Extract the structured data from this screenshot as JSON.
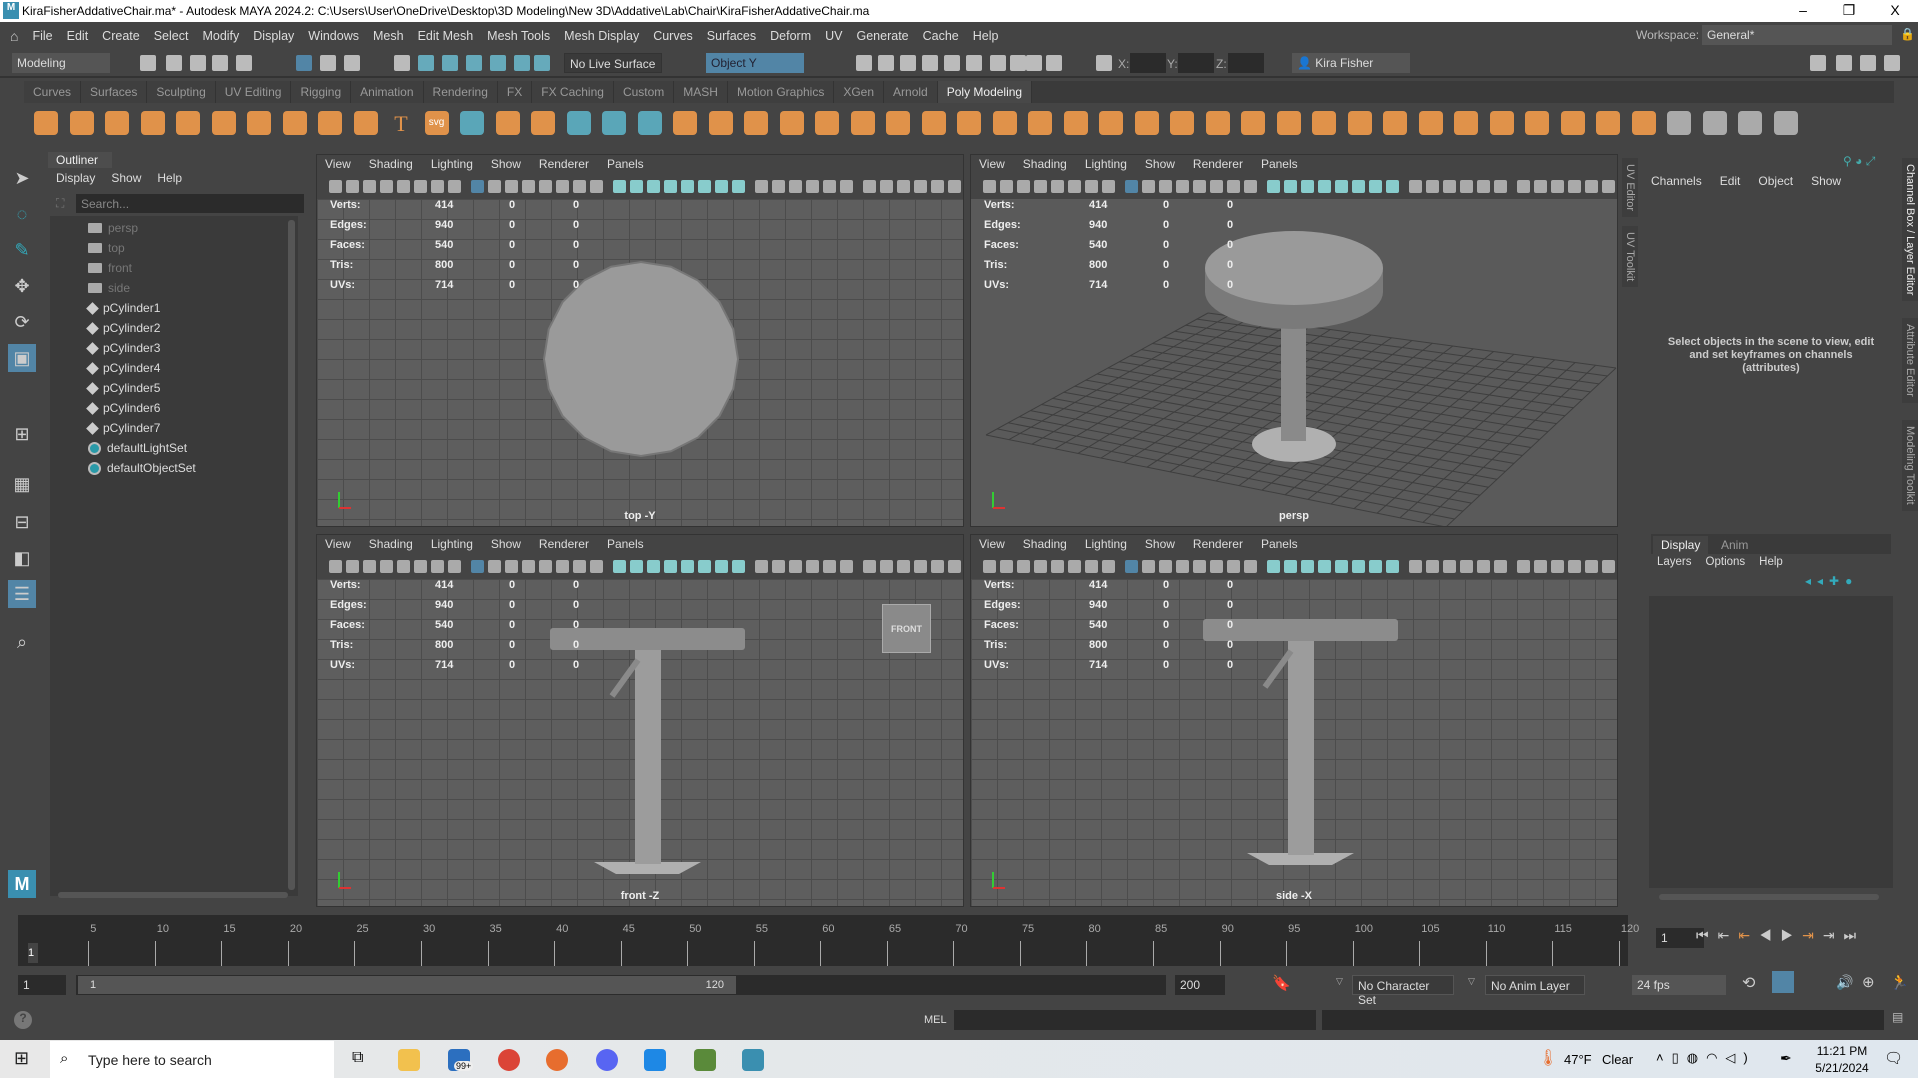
{
  "window": {
    "title": "KiraFisherAddativeChair.ma* - Autodesk MAYA 2024.2: C:\\Users\\User\\OneDrive\\Desktop\\3D Modeling\\New 3D\\Addative\\Lab\\Chair\\KiraFisherAddativeChair.ma",
    "logo": "M",
    "minimize": "–",
    "maximize": "❐",
    "close": "X"
  },
  "menu": [
    "File",
    "Edit",
    "Create",
    "Select",
    "Modify",
    "Display",
    "Windows",
    "Mesh",
    "Edit Mesh",
    "Mesh Tools",
    "Mesh Display",
    "Curves",
    "Surfaces",
    "Deform",
    "UV",
    "Generate",
    "Cache",
    "Help"
  ],
  "workspace": {
    "label": "Workspace:",
    "value": "General*"
  },
  "toolbar": {
    "mode": "Modeling",
    "live_surface": "No Live Surface",
    "symmetry": "Object Y",
    "x_label": "X:",
    "y_label": "Y:",
    "z_label": "Z:",
    "user": "Kira Fisher"
  },
  "shelf": {
    "tabs": [
      "Curves",
      "Surfaces",
      "Sculpting",
      "UV Editing",
      "Rigging",
      "Animation",
      "Rendering",
      "FX",
      "FX Caching",
      "Custom",
      "MASH",
      "Motion Graphics",
      "XGen",
      "Arnold",
      "Poly Modeling"
    ],
    "active": "Poly Modeling",
    "svg_label": "svg",
    "text_label": "T"
  },
  "outliner": {
    "tab": "Outliner",
    "menu": [
      "Display",
      "Show",
      "Help"
    ],
    "search_placeholder": "Search...",
    "items": [
      {
        "name": "persp",
        "type": "cam"
      },
      {
        "name": "top",
        "type": "cam"
      },
      {
        "name": "front",
        "type": "cam"
      },
      {
        "name": "side",
        "type": "cam"
      },
      {
        "name": "pCylinder1",
        "type": "mesh"
      },
      {
        "name": "pCylinder2",
        "type": "mesh"
      },
      {
        "name": "pCylinder3",
        "type": "mesh"
      },
      {
        "name": "pCylinder4",
        "type": "mesh"
      },
      {
        "name": "pCylinder5",
        "type": "mesh"
      },
      {
        "name": "pCylinder6",
        "type": "mesh"
      },
      {
        "name": "pCylinder7",
        "type": "mesh"
      },
      {
        "name": "defaultLightSet",
        "type": "set"
      },
      {
        "name": "defaultObjectSet",
        "type": "set"
      }
    ]
  },
  "viewport_menu": [
    "View",
    "Shading",
    "Lighting",
    "Show",
    "Renderer",
    "Panels"
  ],
  "hud": [
    {
      "label": "Verts:",
      "v": [
        "414",
        "0",
        "0"
      ]
    },
    {
      "label": "Edges:",
      "v": [
        "940",
        "0",
        "0"
      ]
    },
    {
      "label": "Faces:",
      "v": [
        "540",
        "0",
        "0"
      ]
    },
    {
      "label": "Tris:",
      "v": [
        "800",
        "0",
        "0"
      ]
    },
    {
      "label": "UVs:",
      "v": [
        "714",
        "0",
        "0"
      ]
    }
  ],
  "viewports": [
    {
      "id": "top",
      "label": "top -Y"
    },
    {
      "id": "persp",
      "label": "persp"
    },
    {
      "id": "front",
      "label": "front -Z",
      "cube": "FRONT"
    },
    {
      "id": "side",
      "label": "side -X"
    }
  ],
  "side_tabs": {
    "left": [
      "UV Editor",
      "UV Toolkit"
    ],
    "right": [
      "Channel Box / Layer Editor",
      "Attribute Editor",
      "Modeling Toolkit"
    ]
  },
  "channel_box": {
    "menu": [
      "Channels",
      "Edit",
      "Object",
      "Show"
    ],
    "message": "Select objects in the scene to view, edit and set keyframes on channels (attributes)",
    "layer_tabs": [
      "Display",
      "Anim"
    ],
    "layer_menu": [
      "Layers",
      "Options",
      "Help"
    ]
  },
  "timeline": {
    "start": 1,
    "end": 120,
    "step": 5,
    "current": "1",
    "current_field": "1"
  },
  "range": {
    "start_field": "1",
    "range_start": "1",
    "range_end": "120",
    "end_field": "200",
    "character_set": "No Character Set",
    "anim_layer": "No Anim Layer",
    "fps": "24 fps"
  },
  "command": {
    "lang": "MEL",
    "help": "?"
  },
  "taskbar": {
    "search": "Type here to search",
    "weather_temp": "47°F",
    "weather": "Clear",
    "time": "11:21 PM",
    "date": "5/21/2024",
    "mail_badge": "99+"
  },
  "colors": {
    "accent": "#5285a6",
    "shelf_icon": "#e0924a",
    "viewport_bg": "#5e5e5e"
  }
}
